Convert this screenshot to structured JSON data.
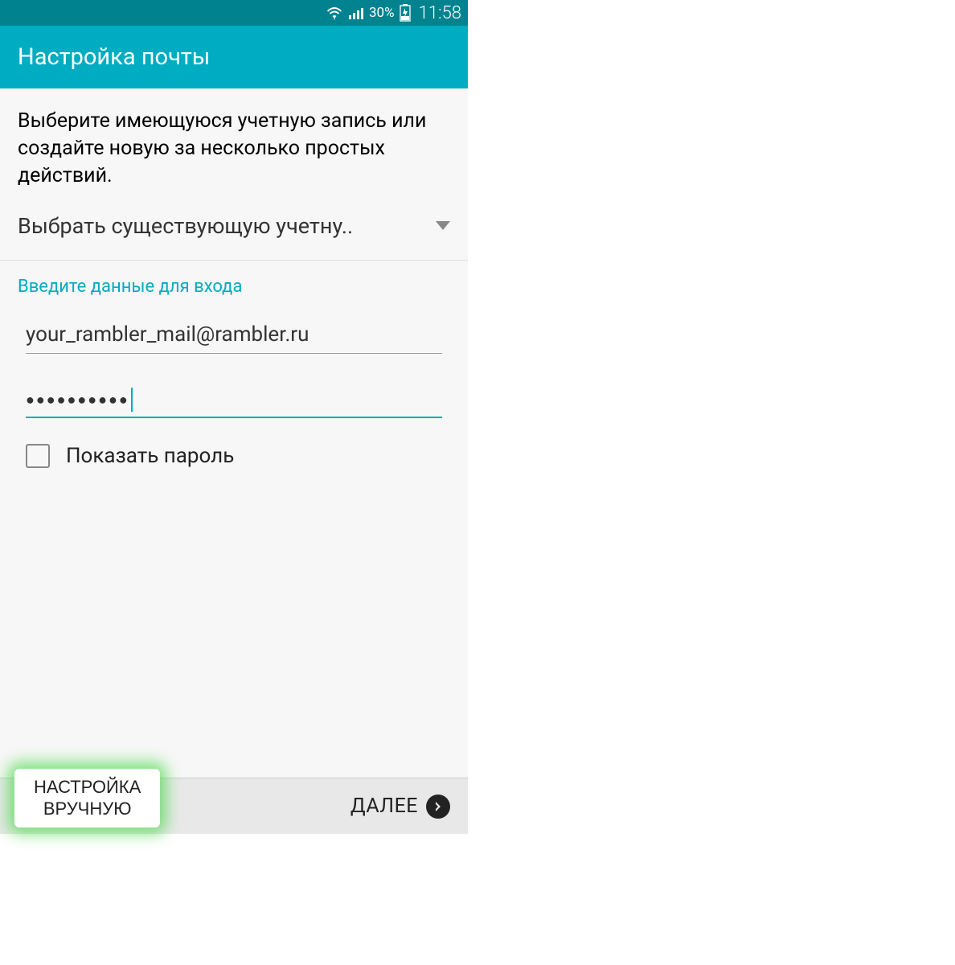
{
  "status_bar": {
    "battery_percent": "30%",
    "time": "11:58"
  },
  "header": {
    "title": "Настройка почты"
  },
  "main": {
    "instruction": "Выберите имеющуюся учетную запись или создайте новую за несколько простых действий.",
    "dropdown_label": "Выбрать существующую учетну..",
    "section_label": "Введите данные для входа",
    "email_value": "your_rambler_mail@rambler.ru",
    "password_dots": "●●●●●●●●●●",
    "show_password_label": "Показать пароль"
  },
  "footer": {
    "manual_line1": "НАСТРОЙКА",
    "manual_line2": "ВРУЧНУЮ",
    "next_label": "ДАЛЕЕ"
  },
  "colors": {
    "status_bar_bg": "#00838f",
    "header_bg": "#00acc1",
    "accent": "#00acc1",
    "highlight_glow": "#4cd84a"
  }
}
